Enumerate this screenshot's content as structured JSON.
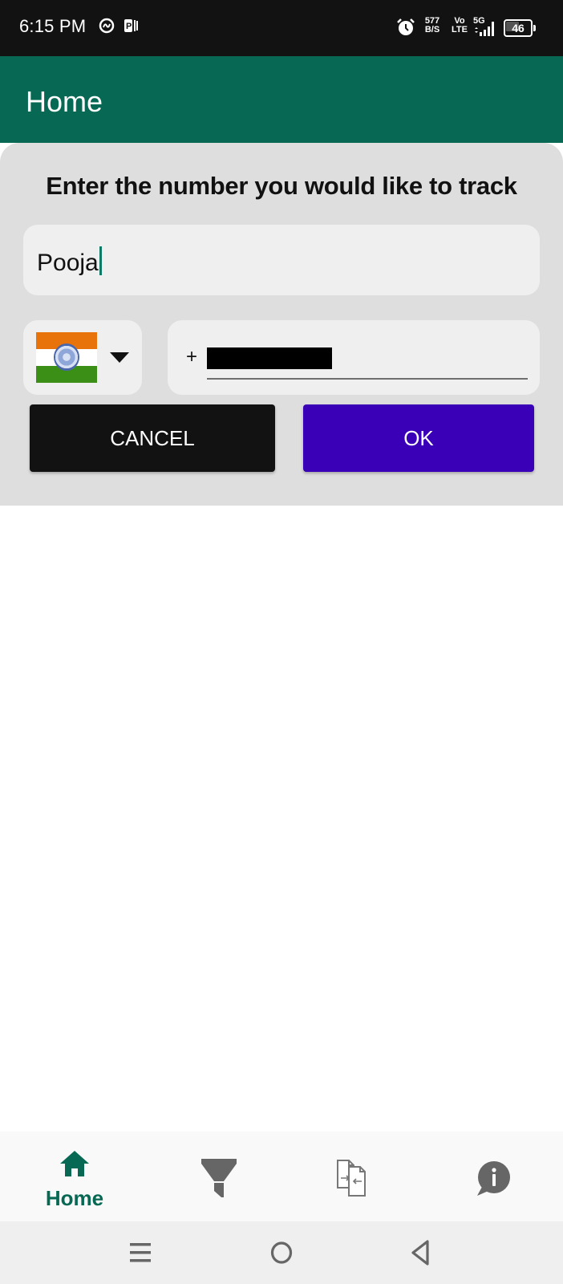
{
  "status_bar": {
    "time": "6:15 PM",
    "notification_icons": [
      "sync-app-icon",
      "parking-app-icon"
    ],
    "alarm_icon": "alarm-clock-icon",
    "network_speed_value": "577",
    "network_speed_unit": "B/S",
    "volte_top": "Vo",
    "volte_bottom": "LTE",
    "network_type": "5G",
    "battery_level": "46"
  },
  "app_bar": {
    "title": "Home"
  },
  "dialog": {
    "title": "Enter the number you would like to track",
    "name_field_value": "Pooja",
    "country": {
      "name": "India",
      "flag_icon": "india-flag-icon"
    },
    "phone_prefix": "+",
    "phone_value_redacted": true,
    "cancel_label": "CANCEL",
    "ok_label": "OK",
    "colors": {
      "ok_button": "#3a00b8",
      "cancel_button": "#121212",
      "caret": "#0f7a66"
    }
  },
  "bottom_nav": {
    "items": [
      {
        "id": "home",
        "label": "Home",
        "icon": "home-icon",
        "active": true
      },
      {
        "id": "filter",
        "label": "",
        "icon": "filter-icon",
        "active": false
      },
      {
        "id": "compare",
        "label": "",
        "icon": "compare-documents-icon",
        "active": false
      },
      {
        "id": "info",
        "label": "",
        "icon": "info-bubble-icon",
        "active": false
      }
    ],
    "active_color": "#076954",
    "inactive_color": "#666666"
  },
  "system_nav": {
    "buttons": [
      "recents",
      "home",
      "back"
    ]
  },
  "theme": {
    "primary": "#076954",
    "dialog_background": "#dedede",
    "field_background": "#efefef"
  }
}
